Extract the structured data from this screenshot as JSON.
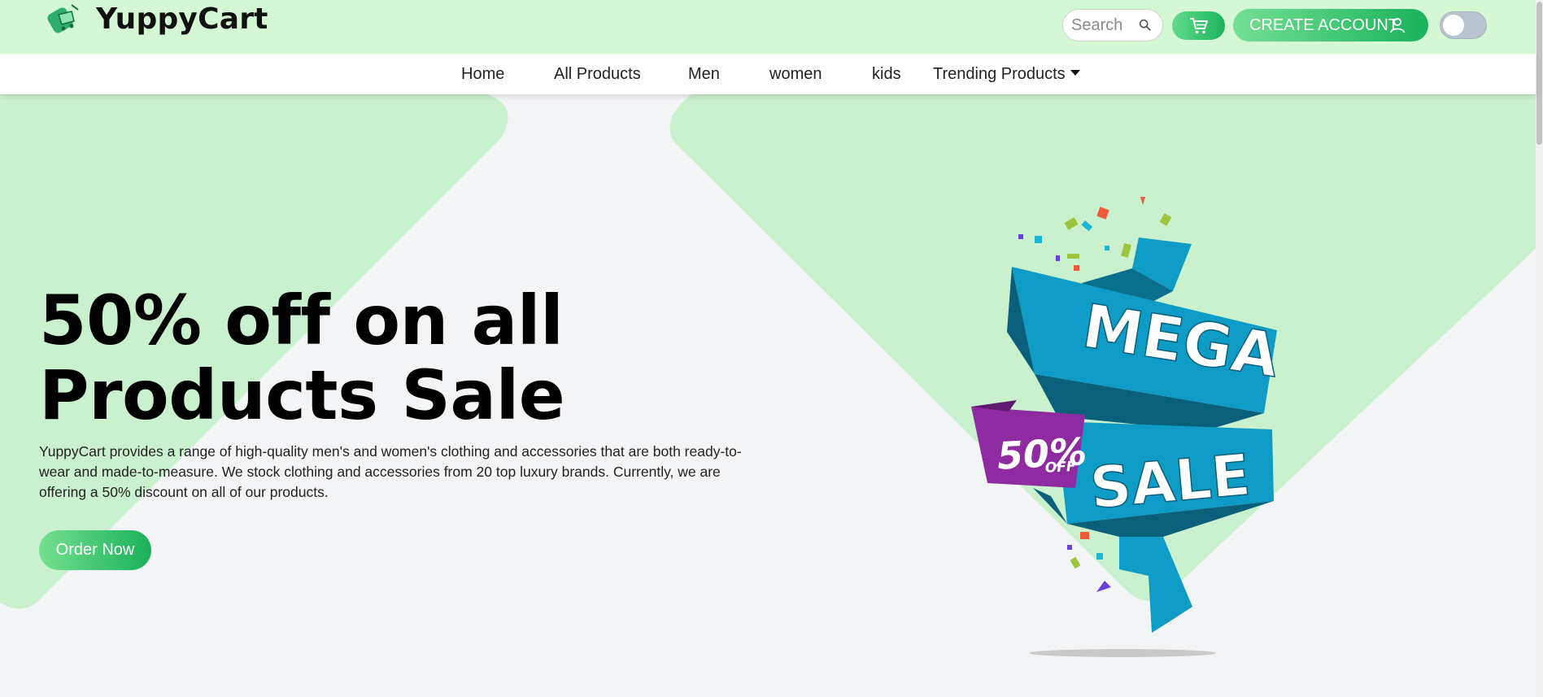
{
  "brand": {
    "name": "YuppyCart",
    "logo_icon": "shopping-cart-logo-icon"
  },
  "header": {
    "search_placeholder": "Search",
    "search_icon": "search-icon",
    "cart_icon": "cart-icon",
    "create_account_label": "CREATE ACCOUNT",
    "user_icon": "user-icon",
    "theme_toggle_on": false
  },
  "nav": {
    "items": [
      "Home",
      "All Products",
      "Men",
      "women",
      "kids",
      "Trending Products"
    ]
  },
  "hero": {
    "title_line1": "50% off on all",
    "title_line2": "Products Sale",
    "description": "YuppyCart provides a range of high-quality men's and women's clothing and accessories that are both ready-to-wear and made-to-measure. We stock clothing and accessories from 20 top luxury brands. Currently, we are offering a 50% discount on all of our products.",
    "cta_label": "Order Now"
  },
  "sale_banner": {
    "line1": "MEGA",
    "line2": "SALE",
    "badge_percent": "50%",
    "badge_suffix": "OFF"
  },
  "colors": {
    "header_bg": "#d3f8d3",
    "hero_shape": "#caf1cd",
    "accent_green": "#1bb35c",
    "ribbon_blue": "#0e9cc6",
    "badge_purple": "#8e2ba1"
  }
}
